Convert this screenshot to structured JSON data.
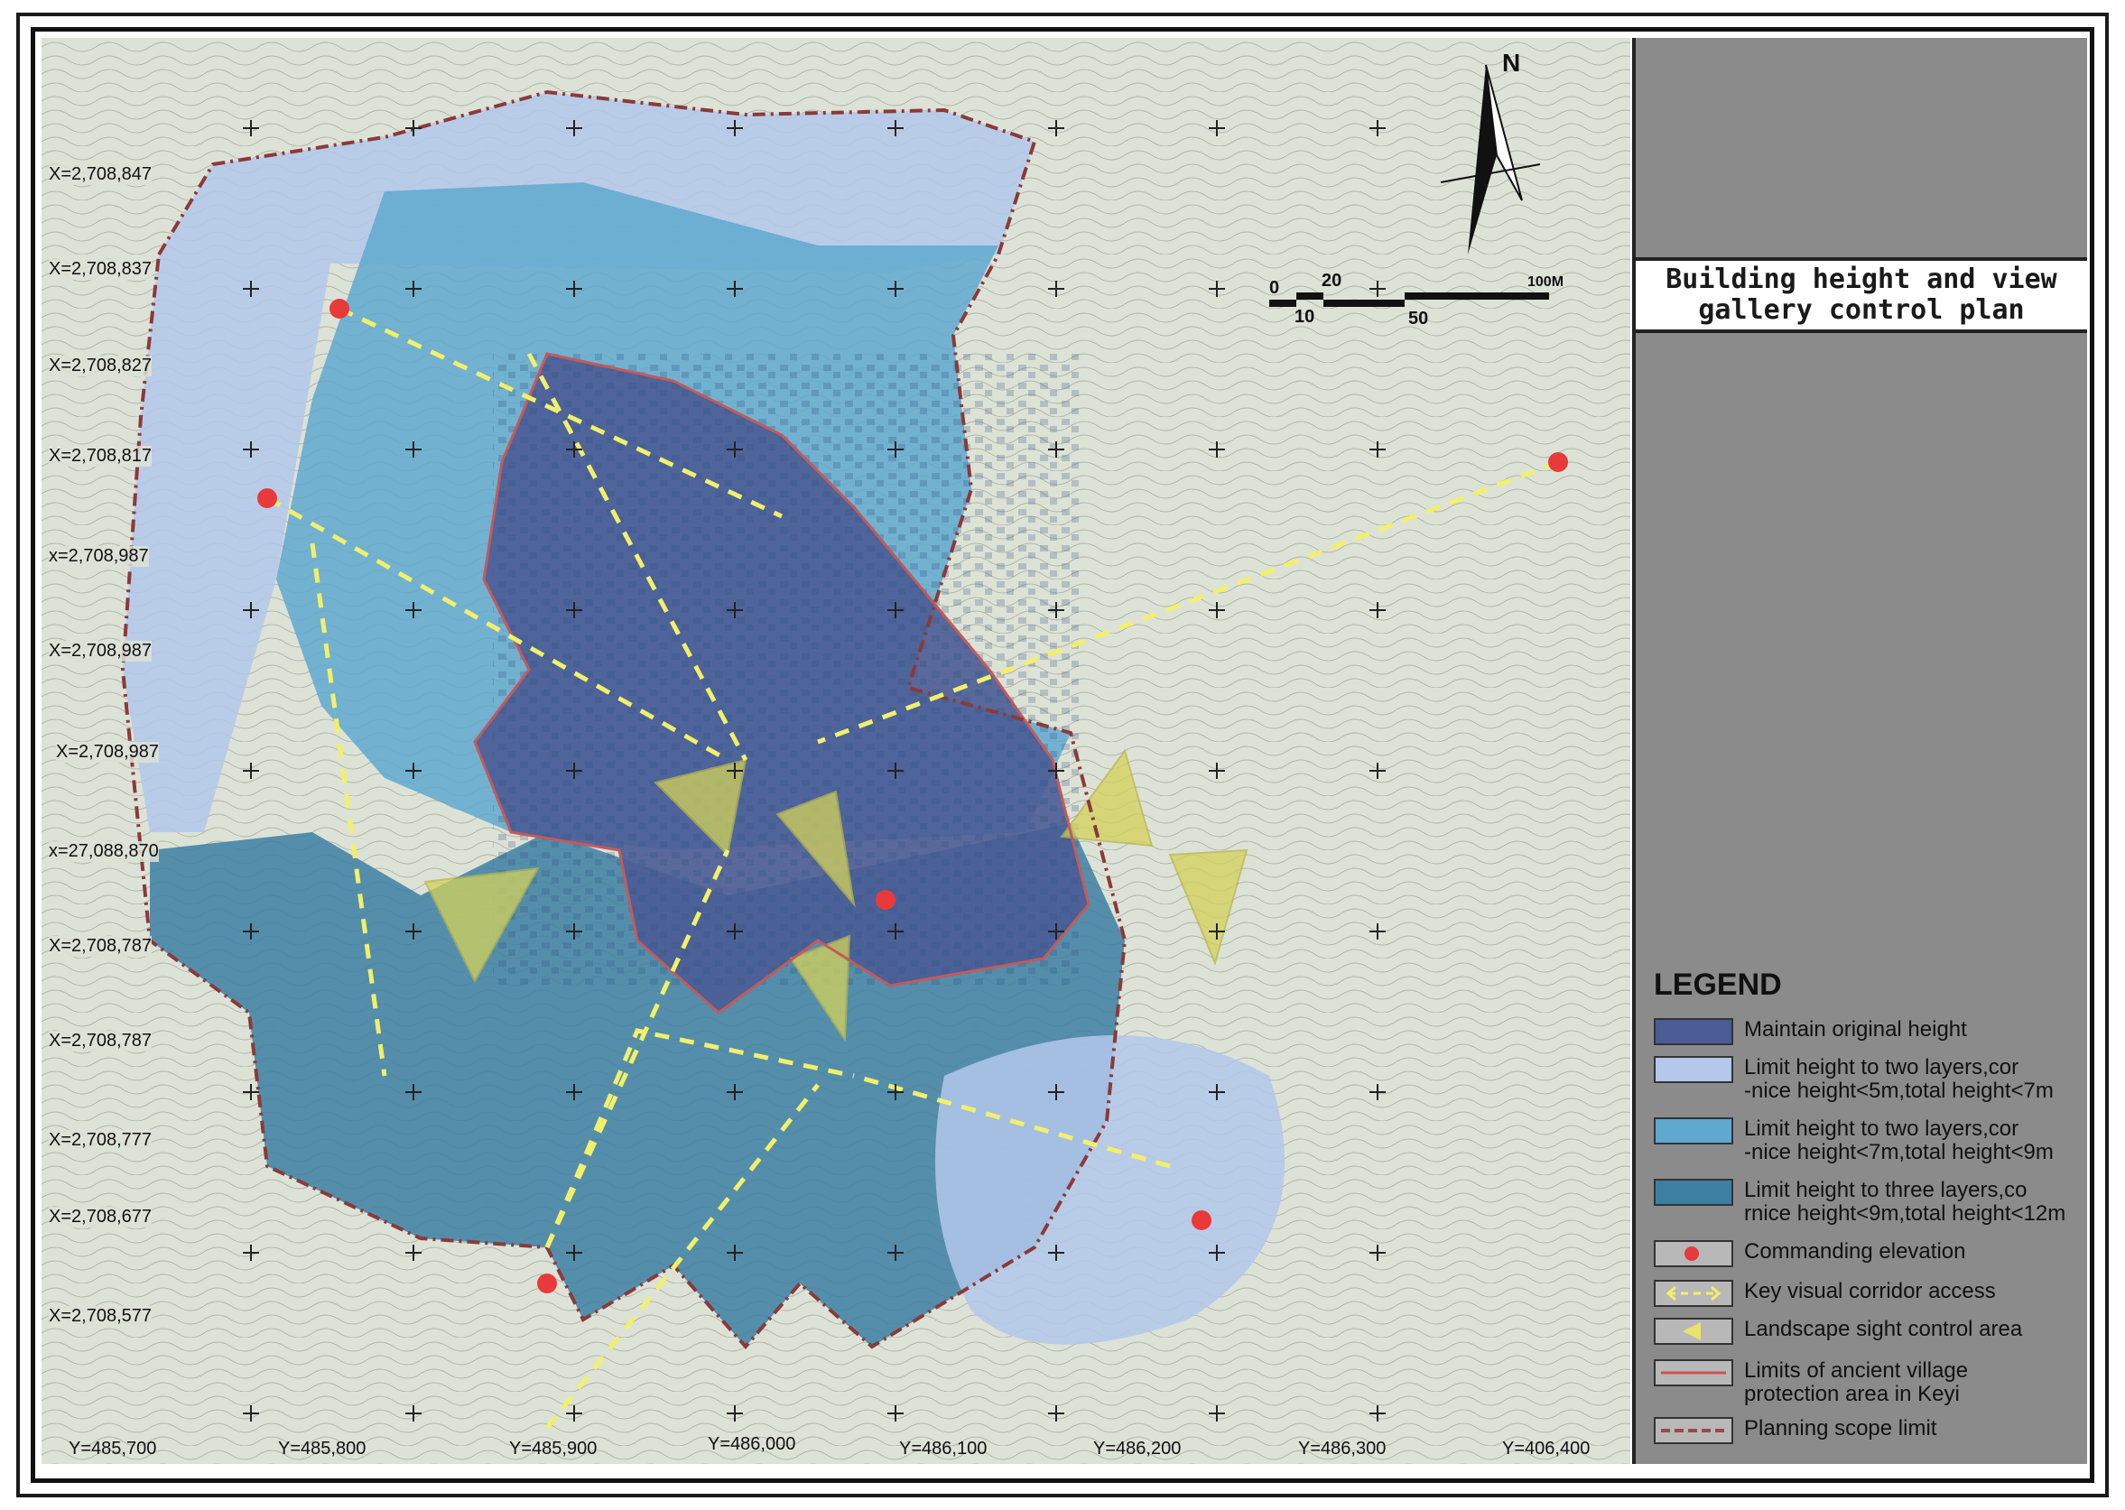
{
  "title": "Building height and view\ngallery control plan",
  "legend_heading": "LEGEND",
  "legend": [
    {
      "label": "Maintain original height",
      "color": "#4a5c95",
      "symbol": "fill"
    },
    {
      "label": "Limit height to two layers,cor\n-nice height<5m,total height<7m",
      "color": "#b3c8ea",
      "symbol": "fill"
    },
    {
      "label": "Limit height to two layers,cor\n-nice height<7m,total height<9m",
      "color": "#5fa8cf",
      "symbol": "fill"
    },
    {
      "label": "Limit height to three layers,co\nrnice height<9m,total height<12m",
      "color": "#3d7fa3",
      "symbol": "fill"
    },
    {
      "label": "Commanding elevation",
      "color": "#e83a3a",
      "symbol": "star"
    },
    {
      "label": "Key visual corridor access",
      "color": "#f2f06a",
      "symbol": "arrows"
    },
    {
      "label": "Landscape sight control area",
      "color": "#e8e46a",
      "symbol": "triangle"
    },
    {
      "label": "Limits of ancient village\nprotection area in Keyi",
      "color": "#d05050",
      "symbol": "line"
    },
    {
      "label": "Planning scope limit",
      "color": "#9a4a4a",
      "symbol": "dashline"
    }
  ],
  "x_coords": [
    "X=2,708,847",
    "X=2,708,837",
    "X=2,708,827",
    "X=2,708,817",
    "x=2,708,987",
    "X=2,708,987",
    "X=2,708,987",
    "x=27,088,870",
    "X=2,708,787",
    "X=2,708,787",
    "X=2,708,777",
    "X=2,708,677",
    "X=2,708,577"
  ],
  "y_coords": [
    "Y=485,700",
    "Y=485,800",
    "Y=485,900",
    "Y=486,000",
    "Y=486,100",
    "Y=486,200",
    "Y=486,300",
    "Y=406,400"
  ],
  "north_label": "N",
  "scale": {
    "labels": [
      "0",
      "10",
      "20",
      "50",
      "100M"
    ]
  },
  "colors": {
    "panel": "#8b8b8b",
    "map_bg": "#dde2d6"
  }
}
